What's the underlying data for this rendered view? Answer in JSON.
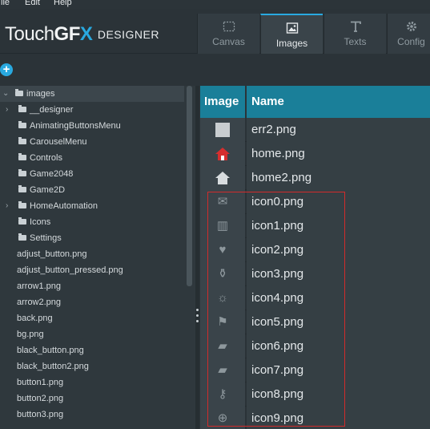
{
  "menubar": {
    "file": "ile",
    "edit": "Edit",
    "help": "Help"
  },
  "logo": {
    "touch": "Touch",
    "gf": "GF",
    "x": "X",
    "sub": "DESIGNER"
  },
  "tabs": [
    {
      "label": "Canvas",
      "icon": "canvas-icon"
    },
    {
      "label": "Images",
      "icon": "image-icon"
    },
    {
      "label": "Texts",
      "icon": "text-icon"
    },
    {
      "label": "Config",
      "icon": "gear-icon"
    }
  ],
  "toolbar": {
    "add": "+"
  },
  "tree": {
    "root": "images",
    "items": [
      {
        "label": "__designer",
        "type": "folder",
        "expandable": true
      },
      {
        "label": "AnimatingButtonsMenu",
        "type": "folder",
        "expandable": false
      },
      {
        "label": "CarouselMenu",
        "type": "folder",
        "expandable": false
      },
      {
        "label": "Controls",
        "type": "folder",
        "expandable": false
      },
      {
        "label": "Game2048",
        "type": "folder",
        "expandable": false
      },
      {
        "label": "Game2D",
        "type": "folder",
        "expandable": false
      },
      {
        "label": "HomeAutomation",
        "type": "folder",
        "expandable": true
      },
      {
        "label": "Icons",
        "type": "folder",
        "expandable": false
      },
      {
        "label": "Settings",
        "type": "folder",
        "expandable": false
      },
      {
        "label": "adjust_button.png",
        "type": "file"
      },
      {
        "label": "adjust_button_pressed.png",
        "type": "file"
      },
      {
        "label": "arrow1.png",
        "type": "file"
      },
      {
        "label": "arrow2.png",
        "type": "file"
      },
      {
        "label": "back.png",
        "type": "file"
      },
      {
        "label": "bg.png",
        "type": "file"
      },
      {
        "label": "black_button.png",
        "type": "file"
      },
      {
        "label": "black_button2.png",
        "type": "file"
      },
      {
        "label": "button1.png",
        "type": "file"
      },
      {
        "label": "button2.png",
        "type": "file"
      },
      {
        "label": "button3.png",
        "type": "file"
      }
    ]
  },
  "table": {
    "headers": {
      "image": "Image",
      "name": "Name"
    },
    "rows": [
      {
        "name": "err2.png",
        "icon": "blank-square-icon",
        "glyph": ""
      },
      {
        "name": "home.png",
        "icon": "home-red-icon",
        "glyph": ""
      },
      {
        "name": "home2.png",
        "icon": "home-gray-icon",
        "glyph": ""
      },
      {
        "name": "icon0.png",
        "icon": "mail-icon",
        "glyph": "✉"
      },
      {
        "name": "icon1.png",
        "icon": "list-icon",
        "glyph": "▥"
      },
      {
        "name": "icon2.png",
        "icon": "heartbeat-icon",
        "glyph": "♥"
      },
      {
        "name": "icon3.png",
        "icon": "bottle-icon",
        "glyph": "⚱"
      },
      {
        "name": "icon4.png",
        "icon": "bulb-icon",
        "glyph": "☼"
      },
      {
        "name": "icon5.png",
        "icon": "map-icon",
        "glyph": "⚑"
      },
      {
        "name": "icon6.png",
        "icon": "folder-plus-icon",
        "glyph": "▰"
      },
      {
        "name": "icon7.png",
        "icon": "folder-search-icon",
        "glyph": "▰"
      },
      {
        "name": "icon8.png",
        "icon": "key-icon",
        "glyph": "⚷"
      },
      {
        "name": "icon9.png",
        "icon": "globe-icon",
        "glyph": "⊕"
      }
    ]
  },
  "colors": {
    "accent": "#29a9e0",
    "header": "#1a7f99",
    "highlight": "#d12b2b",
    "home_red": "#d62e2e"
  }
}
